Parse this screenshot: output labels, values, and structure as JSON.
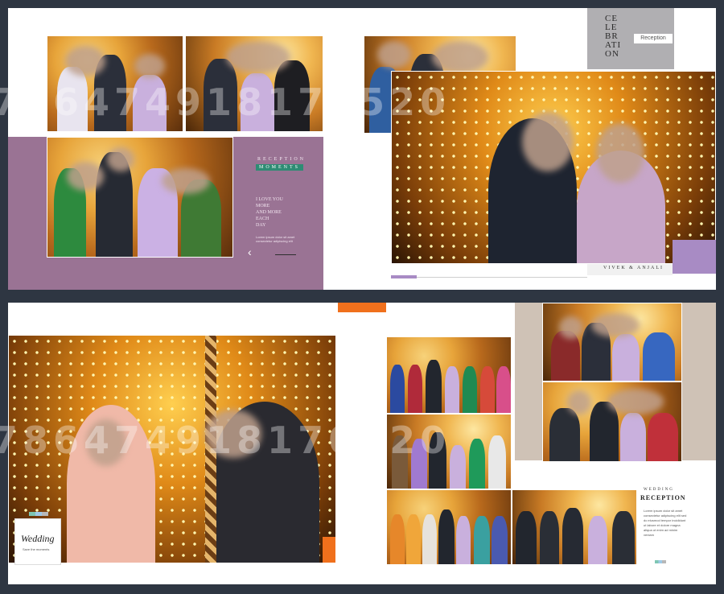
{
  "top_left_panel": {
    "section_title": "RECEPTION",
    "section_subtitle": "MOMENTS",
    "quote": "I LOVE YOU\nMORE\nAND MORE\nEACH\nDAY",
    "caption_line1": "Lorem ipsum dolor sit amet",
    "caption_line2": "consectetur adipiscing elit"
  },
  "top_right_panel": {
    "celebration_title": "CE\nLE\nBR\nATI\nON",
    "reception_label": "Reception",
    "couple_names": "VIVEK & ANJALI"
  },
  "bottom_left_panel": {
    "logo_script": "Wedding",
    "logo_subtext": "Save the moments"
  },
  "bottom_right_panel": {
    "title_small": "WEDDING",
    "title_large": "RECEPTION",
    "body_text": "Lorem ipsum dolor sit amet\nconsectetur adipiscing elit sed\ndo eiusmod tempor incididunt\nut labore et dolore magna\naliqua ut enim ad minim\nveniam"
  },
  "watermark": "786474918170520",
  "colors": {
    "mauve": "#9a7394",
    "lavender": "#a88bc4",
    "orange": "#f0701c",
    "teal": "#2e8c74",
    "beige": "#cfc2b6"
  }
}
